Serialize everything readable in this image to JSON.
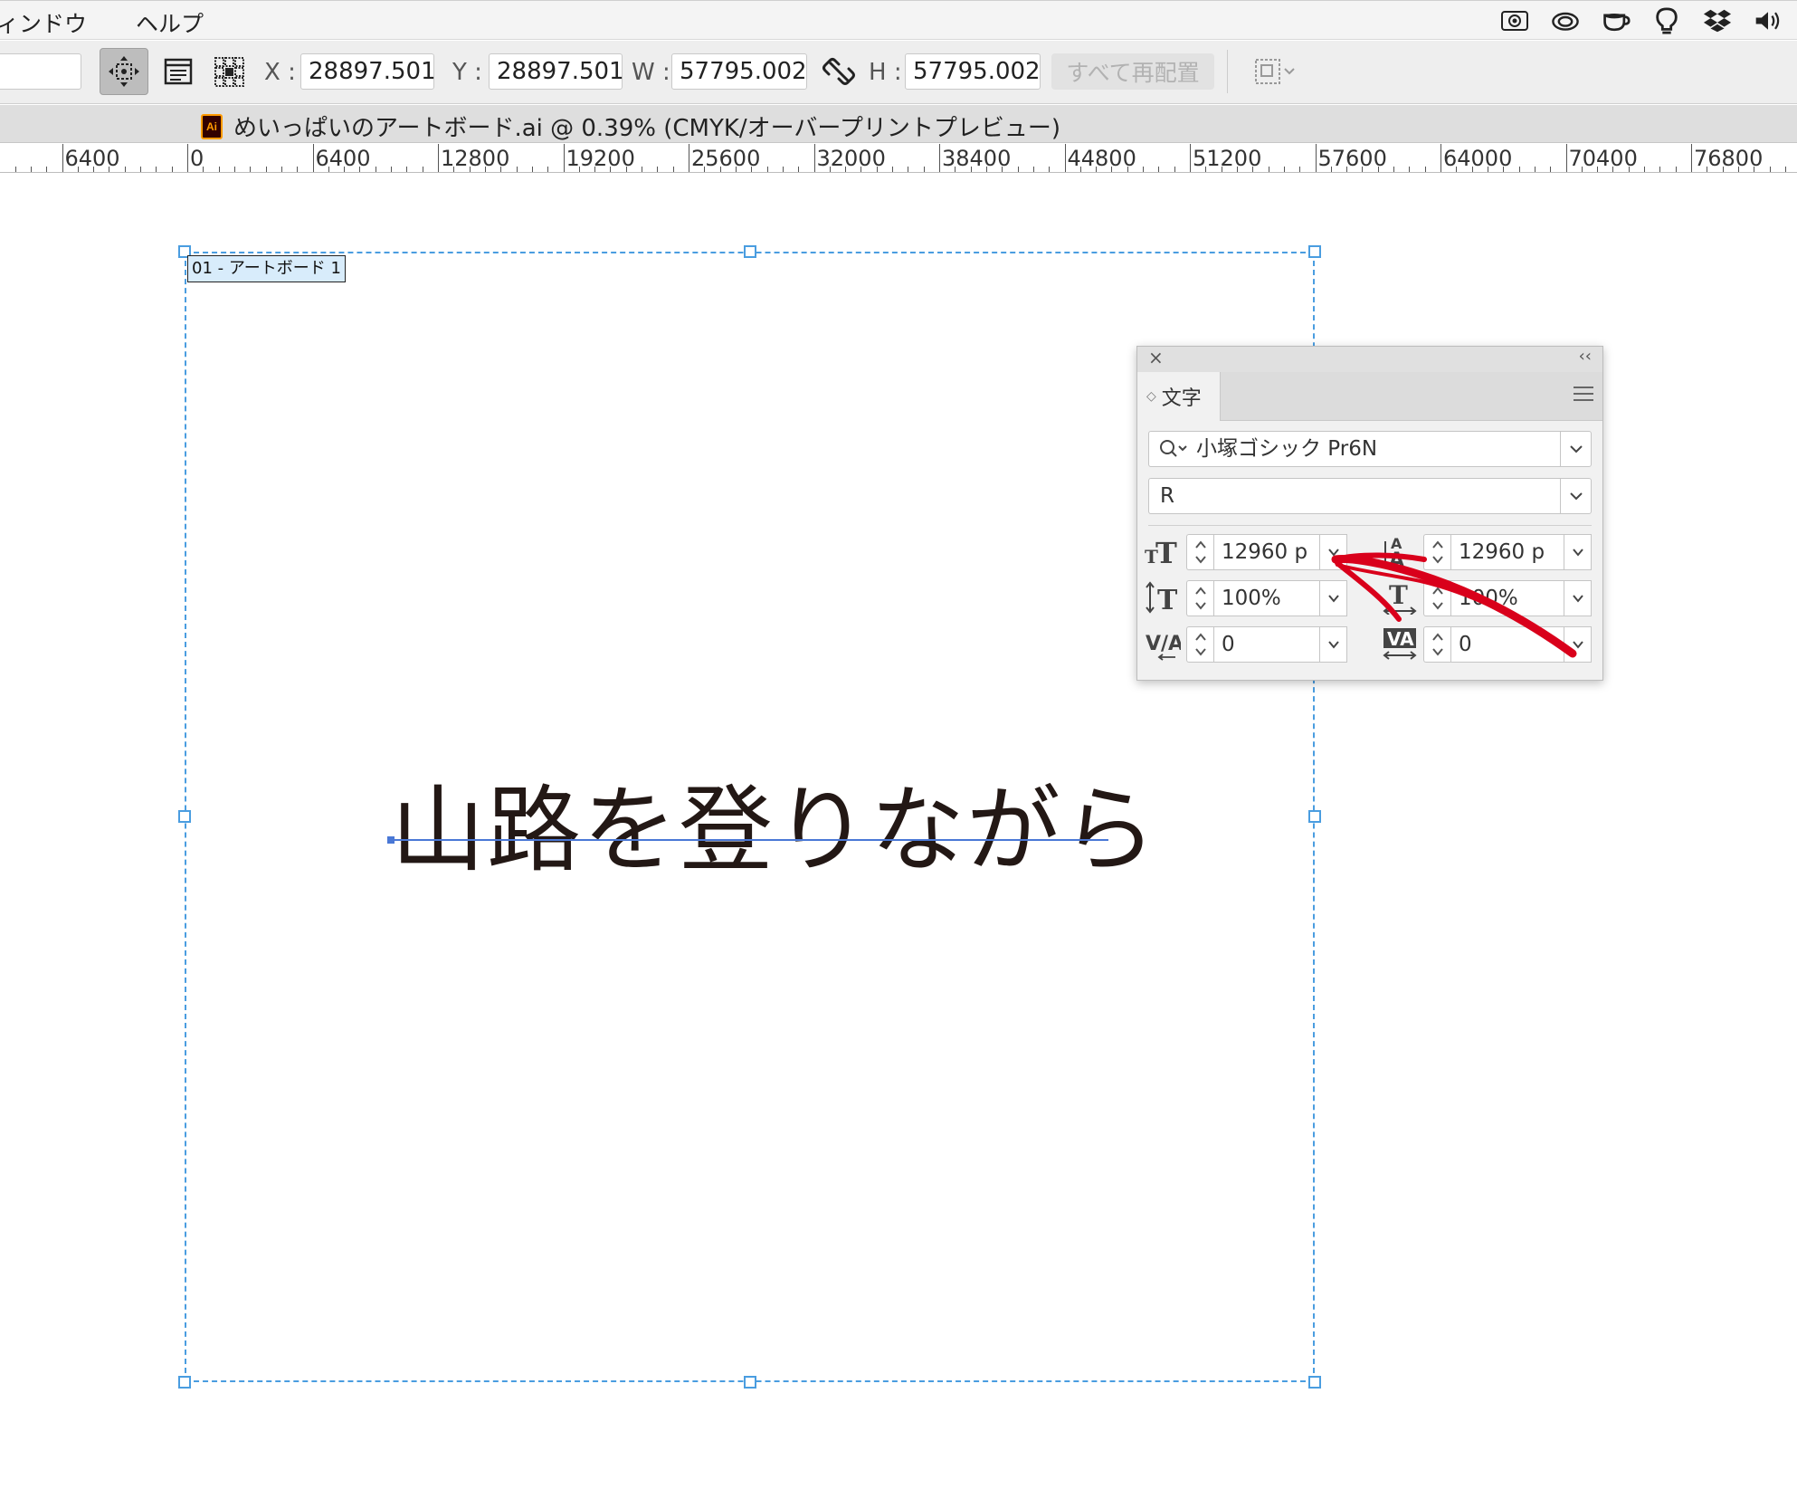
{
  "menubar": {
    "items": [
      "ィンドウ",
      "ヘルプ"
    ],
    "status_icons": [
      "screenshot-icon",
      "creative-cloud-icon",
      "coffee-cup-icon",
      "lightbulb-icon",
      "dropbox-icon",
      "volume-icon"
    ]
  },
  "controlbar": {
    "x_label": "X :",
    "x_value": "28897.501",
    "y_label": "Y :",
    "y_value": "28897.501",
    "w_label": "W :",
    "w_value": "57795.002",
    "h_label": "H :",
    "h_value": "57795.002",
    "realign_label": "すべて再配置"
  },
  "document": {
    "tab_title": "めいっぱいのアートボード.ai @ 0.39% (CMYK/オーバープリントプレビュー)",
    "app_icon_text": "Ai"
  },
  "ruler": {
    "labels": [
      "0",
      "6400",
      "0",
      "6400",
      "12800",
      "19200",
      "25600",
      "32000",
      "38400",
      "44800",
      "51200",
      "57600",
      "64000",
      "70400",
      "76800"
    ]
  },
  "artboard": {
    "label": "01 - アートボード 1",
    "text": "山路を登りながら"
  },
  "char_panel": {
    "close": "×",
    "collapse": "‹‹",
    "tab_label": "文字",
    "font_family": "小塚ゴシック Pr6N",
    "font_style": "R",
    "font_size": "12960 p",
    "leading": "12960 p",
    "vertical_scale": "100%",
    "horizontal_scale": "100%",
    "kerning": "0",
    "tracking": "0"
  },
  "colors": {
    "selection": "#4a9de0",
    "annotation_arrow": "#d9001b",
    "text": "#231815"
  }
}
